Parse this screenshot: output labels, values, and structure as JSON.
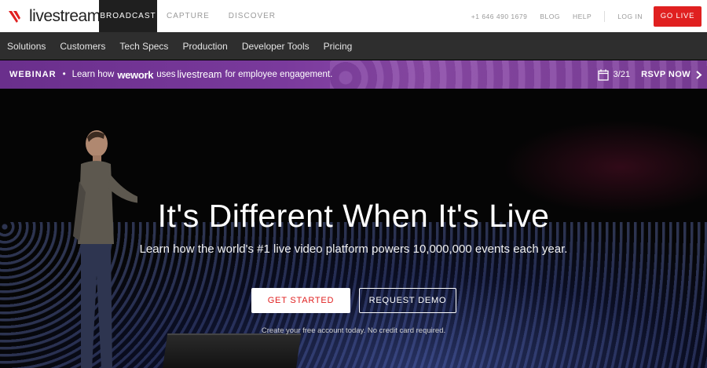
{
  "brand": {
    "name": "livestream",
    "accent": "#e02020"
  },
  "topbar": {
    "tabs": [
      {
        "label": "BROADCAST",
        "active": true
      },
      {
        "label": "CAPTURE"
      },
      {
        "label": "DISCOVER"
      }
    ],
    "phone": "+1 646 490 1679",
    "links": [
      "BLOG",
      "HELP"
    ],
    "login": "LOG IN",
    "go_live": "GO LIVE"
  },
  "subnav": {
    "items": [
      "Solutions",
      "Customers",
      "Tech Specs",
      "Production",
      "Developer Tools",
      "Pricing"
    ]
  },
  "banner": {
    "label": "WEBINAR",
    "bullet": "•",
    "text_pre": "Learn how",
    "partner": "wework",
    "text_mid": "uses",
    "brand": "livestream",
    "text_post": "for employee engagement.",
    "date": "3/21",
    "rsvp": "RSVP NOW",
    "icon": "calendar-icon",
    "color": "#7a3a9c"
  },
  "hero": {
    "headline": "It's Different When It's Live",
    "subhead": "Learn how the world's #1 live video platform powers 10,000,000 events each year.",
    "primary_cta": "GET STARTED",
    "secondary_cta": "REQUEST DEMO",
    "note": "Create your free account today. No credit card required."
  }
}
